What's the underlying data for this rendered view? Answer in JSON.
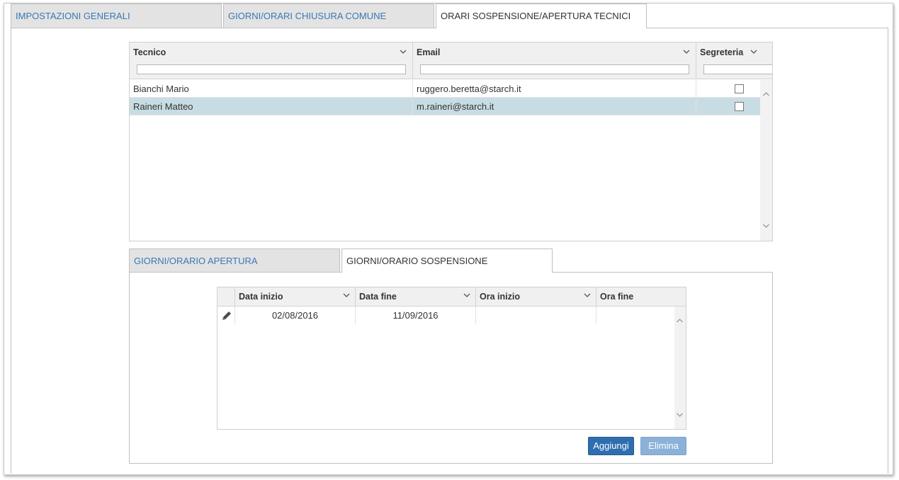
{
  "tabs": [
    {
      "label": "IMPOSTAZIONI GENERALI",
      "active": false
    },
    {
      "label": "GIORNI/ORARI CHIUSURA COMUNE",
      "active": false
    },
    {
      "label": "ORARI SOSPENSIONE/APERTURA TECNICI",
      "active": true
    }
  ],
  "tecnici_grid": {
    "columns": [
      "Tecnico",
      "Email",
      "Segreteria"
    ],
    "rows": [
      {
        "tecnico": "Bianchi Mario",
        "email": "ruggero.beretta@starch.it",
        "segreteria": false,
        "selected": false
      },
      {
        "tecnico": "Raineri Matteo",
        "email": "m.raineri@starch.it",
        "segreteria": false,
        "selected": true
      }
    ]
  },
  "sub_tabs": [
    {
      "label": "GIORNI/ORARIO APERTURA",
      "active": false
    },
    {
      "label": "GIORNI/ORARIO SOSPENSIONE",
      "active": true
    }
  ],
  "sospensione_grid": {
    "columns": [
      "Data inizio",
      "Data fine",
      "Ora inizio",
      "Ora fine"
    ],
    "rows": [
      {
        "data_inizio": "02/08/2016",
        "data_fine": "11/09/2016",
        "ora_inizio": "",
        "ora_fine": ""
      }
    ]
  },
  "buttons": {
    "add": "Aggiungi",
    "delete": "Elimina"
  },
  "icons": {
    "edit": "pencil-icon",
    "sort": "chevron-down-icon",
    "scroll_up": "chevron-up-icon",
    "scroll_down": "chevron-down-icon"
  },
  "colors": {
    "tab_link": "#3a78b5",
    "selected_row": "#c8dde3",
    "primary_button": "#2e6eb0",
    "disabled_button": "#8bb1d8"
  }
}
